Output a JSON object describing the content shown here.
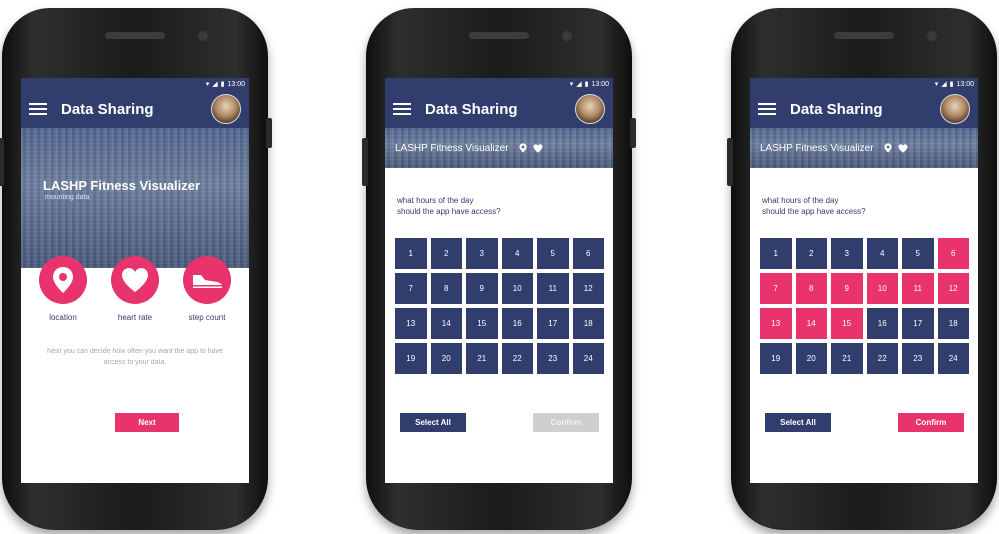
{
  "app": {
    "title": "Data Sharing",
    "status_time": "13:00"
  },
  "colors": {
    "navy": "#313d6c",
    "pink": "#e8336d",
    "disabled": "#cfcfcf"
  },
  "screen1": {
    "hero_title": "LASHP Fitness Visualizer",
    "hero_subtitle": "mounting data",
    "options": [
      {
        "icon": "location-pin-icon",
        "label": "location"
      },
      {
        "icon": "heart-icon",
        "label": "heart rate"
      },
      {
        "icon": "sneaker-icon",
        "label": "step count"
      }
    ],
    "help_text": "Next you can decide how often you want the app to have access to your data.",
    "next_label": "Next"
  },
  "screen2": {
    "header_label": "LASHP Fitness Visualizer",
    "question_line1": "what hours of the day",
    "question_line2": "should the app have access?",
    "hours": [
      "1",
      "2",
      "3",
      "4",
      "5",
      "6",
      "7",
      "8",
      "9",
      "10",
      "11",
      "12",
      "13",
      "14",
      "15",
      "16",
      "17",
      "18",
      "19",
      "20",
      "21",
      "22",
      "23",
      "24"
    ],
    "selected_hours": [],
    "select_all_label": "Select All",
    "confirm_label": "Confirm",
    "confirm_enabled": false
  },
  "screen3": {
    "header_label": "LASHP Fitness Visualizer",
    "question_line1": "what hours of the day",
    "question_line2": "should the app have access?",
    "hours": [
      "1",
      "2",
      "3",
      "4",
      "5",
      "6",
      "7",
      "8",
      "9",
      "10",
      "11",
      "12",
      "13",
      "14",
      "15",
      "16",
      "17",
      "18",
      "19",
      "20",
      "21",
      "22",
      "23",
      "24"
    ],
    "selected_hours": [
      "6",
      "7",
      "8",
      "9",
      "10",
      "11",
      "12",
      "13",
      "14",
      "15"
    ],
    "select_all_label": "Select All",
    "confirm_label": "Confirm",
    "confirm_enabled": true
  }
}
